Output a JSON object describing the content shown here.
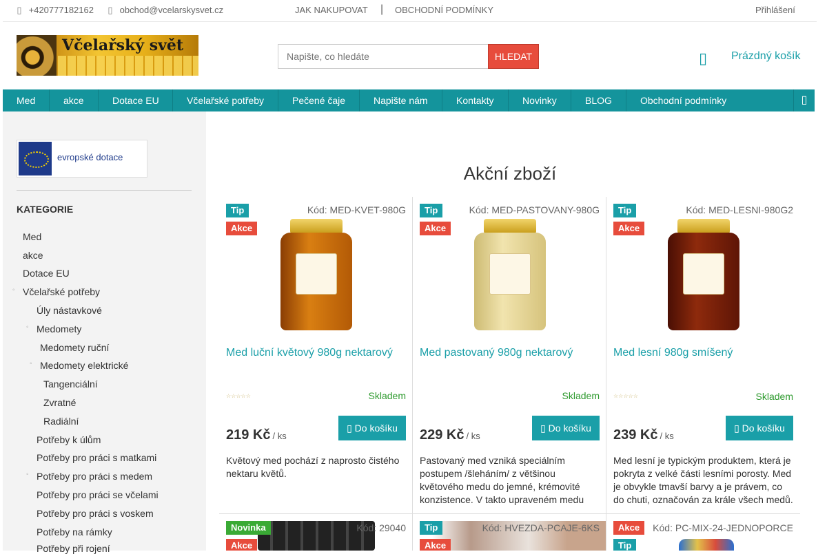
{
  "topbar": {
    "phone": "+420777182162",
    "email": "obchod@vcelarskysvet.cz",
    "link_how": "JAK NAKUPOVAT",
    "separator": "|",
    "link_terms": "OBCHODNÍ PODMÍNKY",
    "login": "Přihlášení",
    "phone_icon": "phone-icon",
    "email_icon": "envelope-icon"
  },
  "header": {
    "logo_text": "Včelařský svět",
    "search_placeholder": "Napište, co hledáte",
    "search_button": "HLEDAT",
    "cart_label": "Prázdný košík",
    "cart_icon": "cart-icon"
  },
  "nav": {
    "items": [
      "Med",
      "akce",
      "Dotace EU",
      "Včelařské potřeby",
      "Pečené čaje",
      "Napište nám",
      "Kontakty",
      "Novinky",
      "BLOG",
      "Obchodní podmínky"
    ],
    "more_icon": "chevron-down-icon"
  },
  "sidebar": {
    "eu_banner": "evropské dotace",
    "categories_title": "KATEGORIE",
    "categories": [
      "Med",
      "akce",
      "Dotace EU",
      "Včelařské potřeby",
      "Úly nástavkové",
      "Medomety",
      "Medomety ruční",
      "Medomety elektrické",
      "Tangenciální",
      "Zvratné",
      "Radiální",
      "Potřeby k úlům",
      "Potřeby pro práci s matkami",
      "Potřeby pro práci s medem",
      "Potřeby pro práci se včelami",
      "Potřeby pro práci s voskem",
      "Potřeby na rámky",
      "Potřeby při rojení"
    ]
  },
  "main": {
    "title": "Akční zboží",
    "products": [
      {
        "badges": [
          "Tip",
          "Akce"
        ],
        "code": "Kód: MED-KVET-980G",
        "name": "Med luční květový 980g nektarový",
        "stars": "☆☆☆☆☆",
        "stock": "Skladem",
        "price": "219 Kč",
        "unit": "/ ks",
        "buy": "Do košíku",
        "desc": "Květový med pochází z naprosto čistého nektaru květů.",
        "honey_color": "#c9700c"
      },
      {
        "badges": [
          "Tip",
          "Akce"
        ],
        "code": "Kód: MED-PASTOVANY-980G",
        "name": "Med pastovaný 980g nektarový",
        "stars": "",
        "stock": "Skladem",
        "price": "229 Kč",
        "unit": "/ ks",
        "buy": "Do košíku",
        "desc": "Pastovaný med vzniká speciálním postupem /šleháním/ z většinou květového medu do jemné, krémovité konzistence. V takto upraveném medu",
        "honey_color": "#eadb9c"
      },
      {
        "badges": [
          "Tip",
          "Akce"
        ],
        "code": "Kód: MED-LESNI-980G2",
        "name": "Med lesní 980g smíšený",
        "stars": "☆☆☆☆☆",
        "stock": "Skladem",
        "price": "239 Kč",
        "unit": "/ ks",
        "buy": "Do košíku",
        "desc": "Med lesní je typickým produktem, která je pokryta z velké části lesními porosty. Med je obvykle tmavší barvy a je právem, co do chuti, označován za krále všech medů.",
        "honey_color": "#7a1f0a"
      }
    ],
    "row2": [
      {
        "badges": [
          "Novinka",
          "Akce"
        ],
        "code": "Kód: 29040"
      },
      {
        "badges": [
          "Tip",
          "Akce"
        ],
        "code": "Kód: HVEZDA-PCAJE-6KS"
      },
      {
        "badges": [
          "Akce",
          "Tip"
        ],
        "code": "Kód: PC-MIX-24-JEDNOPORCE"
      }
    ],
    "buy_icon": "cart-icon"
  }
}
